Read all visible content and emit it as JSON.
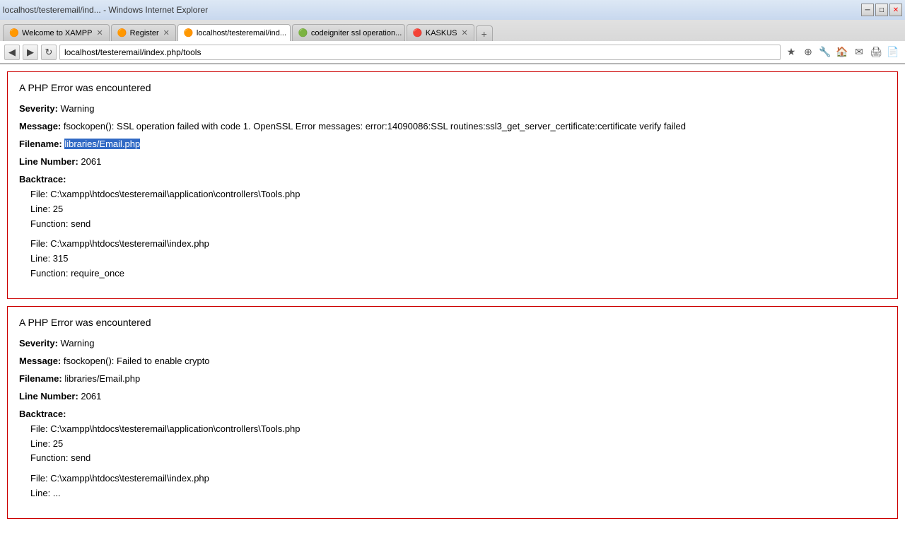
{
  "browser": {
    "tabs": [
      {
        "id": "tab1",
        "label": "Welcome to XAMPP",
        "favicon": "🟠",
        "active": false,
        "url": ""
      },
      {
        "id": "tab2",
        "label": "Register",
        "favicon": "🟠",
        "active": false,
        "url": ""
      },
      {
        "id": "tab3",
        "label": "localhost/testeremail/ind...",
        "favicon": "🟠",
        "active": true,
        "url": "localhost/testeremail/index.php/tools"
      },
      {
        "id": "tab4",
        "label": "codeigniter ssl operation...",
        "favicon": "🟢",
        "active": false,
        "url": ""
      },
      {
        "id": "tab5",
        "label": "KASKUS",
        "favicon": "🔴",
        "active": false,
        "url": ""
      }
    ],
    "address": "localhost/testeremail/index.php/tools",
    "new_tab_label": "+"
  },
  "errors": [
    {
      "title": "A PHP Error was encountered",
      "severity_label": "Severity:",
      "severity_value": "Warning",
      "message_label": "Message:",
      "message_value": "fsockopen(): SSL operation failed with code 1. OpenSSL Error messages: error:14090086:SSL routines:ssl3_get_server_certificate:certificate verify failed",
      "filename_label": "Filename:",
      "filename_value": "libraries/Email.php",
      "filename_highlighted": true,
      "linenumber_label": "Line Number:",
      "linenumber_value": "2061",
      "backtrace_label": "Backtrace:",
      "backtrace_items": [
        {
          "file": "File: C:\\xampp\\htdocs\\testeremail\\application\\controllers\\Tools.php",
          "line": "Line: 25",
          "function": "Function: send"
        },
        {
          "file": "File: C:\\xampp\\htdocs\\testeremail\\index.php",
          "line": "Line: 315",
          "function": "Function: require_once"
        }
      ]
    },
    {
      "title": "A PHP Error was encountered",
      "severity_label": "Severity:",
      "severity_value": "Warning",
      "message_label": "Message:",
      "message_value": "fsockopen(): Failed to enable crypto",
      "filename_label": "Filename:",
      "filename_value": "libraries/Email.php",
      "filename_highlighted": false,
      "linenumber_label": "Line Number:",
      "linenumber_value": "2061",
      "backtrace_label": "Backtrace:",
      "backtrace_items": [
        {
          "file": "File: C:\\xampp\\htdocs\\testeremail\\application\\controllers\\Tools.php",
          "line": "Line: 25",
          "function": "Function: send"
        },
        {
          "file": "File: C:\\xampp\\htdocs\\testeremail\\index.php",
          "line": "Line: ...",
          "function": ""
        }
      ]
    }
  ],
  "nav": {
    "back": "◀",
    "forward": "▶",
    "reload": "↻",
    "stop": "✕"
  }
}
